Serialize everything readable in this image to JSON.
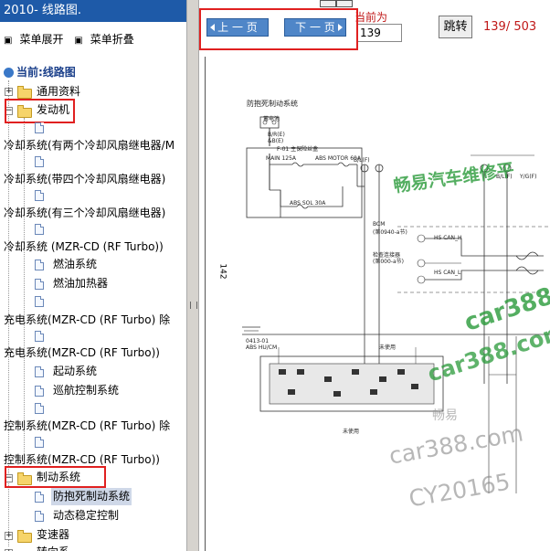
{
  "sidebar": {
    "title": "2010- 线路图.",
    "menu_expand": "菜单展开",
    "menu_collapse": "菜单折叠",
    "current_label": "当前:线路图",
    "items": [
      {
        "label": "通用资料"
      },
      {
        "label": "发动机"
      },
      {
        "label": "冷却系统(有两个冷却风扇继电器/M"
      },
      {
        "label": "冷却系统(带四个冷却风扇继电器)"
      },
      {
        "label": "冷却系统(有三个冷却风扇继电器)"
      },
      {
        "label": "冷却系统 (MZR-CD (RF Turbo))"
      },
      {
        "label": "燃油系统"
      },
      {
        "label": "燃油加热器"
      },
      {
        "label": "充电系统(MZR-CD (RF Turbo)   除"
      },
      {
        "label": "充电系统(MZR-CD (RF Turbo))"
      },
      {
        "label": "起动系统"
      },
      {
        "label": "巡航控制系统"
      },
      {
        "label": "控制系统(MZR-CD (RF Turbo)   除"
      },
      {
        "label": "控制系统(MZR-CD (RF Turbo))"
      },
      {
        "label": "制动系统"
      },
      {
        "label": "防抱死制动系统"
      },
      {
        "label": "动态稳定控制"
      },
      {
        "label": "变速器"
      },
      {
        "label": "转向系"
      }
    ]
  },
  "toolbar": {
    "prev_label": "上 一 页",
    "next_label": "下 一 页",
    "current_page_label": "当前为",
    "page_value": "139",
    "go_label": "跳转",
    "page_count": "139/ 503"
  },
  "diagram": {
    "page_number": "142",
    "title": "防抱死制动系统",
    "battery": "蓄电池",
    "labels": {
      "br": "B/R(E)",
      "bw": "&B(E)",
      "f01": "F-01  主保险丝盒",
      "main": "MAIN 125A",
      "abs_motor": "ABS MOTOR 60A",
      "abs_sol": "ABS SOL 30A",
      "bl": "B/L(F)",
      "yg": "Y/G(F)",
      "bcm": "BCM",
      "bcm_sub": "(第0940-a节)",
      "hs_can_h": "HS CAN_H",
      "hs_can_l": "HS CAN_L",
      "check": "检查连接器",
      "check_sub": "(第000-a节)",
      "module": "0413-01",
      "module_name": "ABS HU/CM",
      "unused": "未使用"
    }
  },
  "watermarks": {
    "brand": "畅易汽车维修平",
    "site1": "car388",
    "site2": "car388.com",
    "site3": "car388.com",
    "small": "畅易",
    "code": "CY20165"
  },
  "colors": {
    "title_bar": "#1e5aa8",
    "nav_button": "#4f86c8",
    "highlight_red": "#e02020",
    "watermark_green": "#2a9a3a"
  }
}
